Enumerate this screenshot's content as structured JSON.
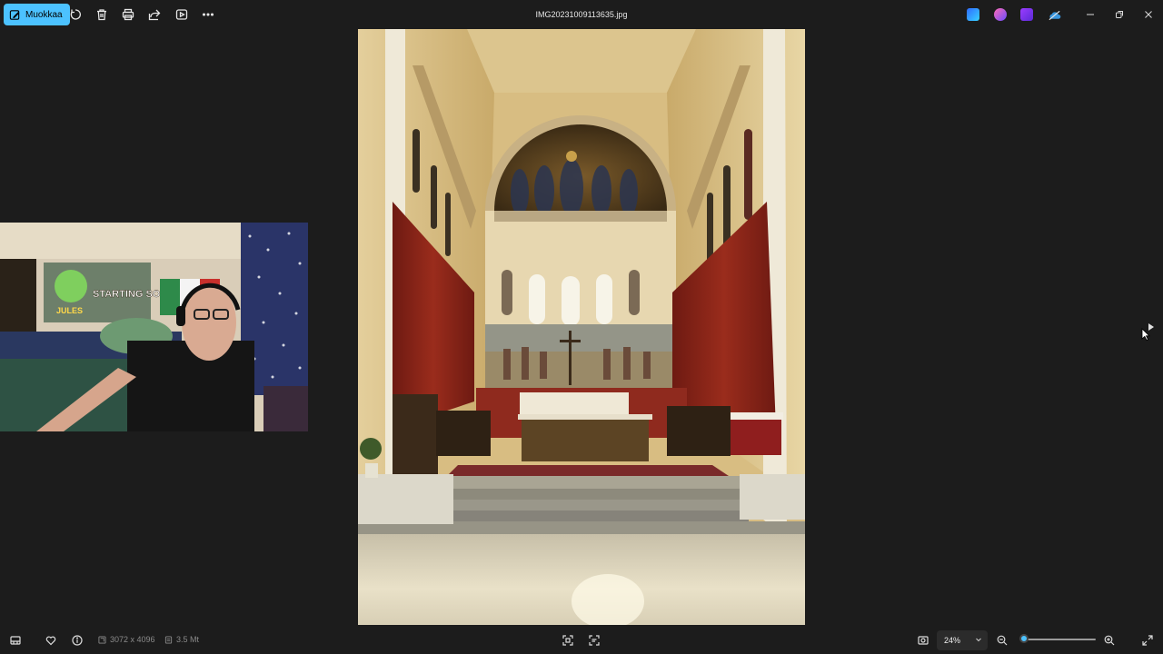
{
  "toolbar": {
    "edit_label": "Muokkaa",
    "icons": [
      "rotate-icon",
      "delete-icon",
      "print-icon",
      "share-icon",
      "slideshow-icon",
      "more-icon"
    ]
  },
  "window": {
    "filename": "IMG20231009113635.jpg",
    "tray_apps": [
      "designer-app-icon",
      "copilot-app-icon",
      "clipchamp-app-icon",
      "onedrive-icon"
    ]
  },
  "image_info": {
    "dimensions": "3072 x 4096",
    "file_size": "3.5 Mt"
  },
  "zoom": {
    "level_text": "24%",
    "level": 0.24
  },
  "colors": {
    "accent": "#4cc2ff",
    "background": "#1c1c1c"
  },
  "webcam": {
    "sign_text": "STARTING SOON",
    "sticker_text": "JULES"
  }
}
